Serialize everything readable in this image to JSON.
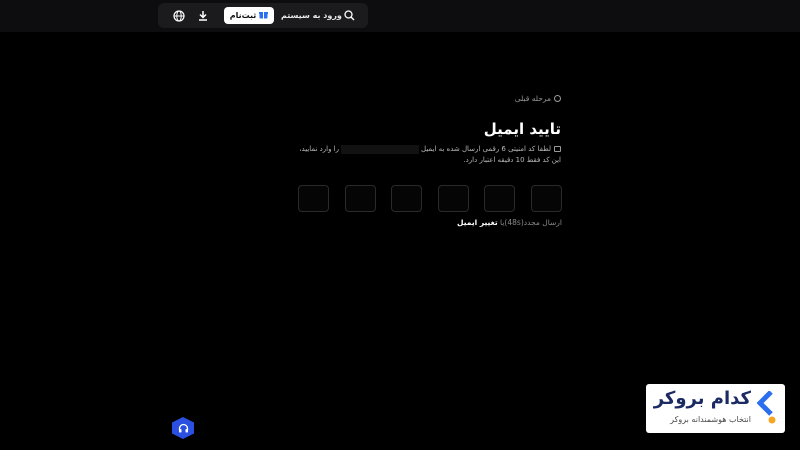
{
  "header": {
    "login_label": "ورود به سیستم",
    "signup_label": "ثبت‌نام"
  },
  "verify": {
    "back_label": "مرحله قبلی",
    "title": "تایید ایمیل",
    "desc_line1_a": "لطفا کد امنیتی 6 رقمی ارسال شده به ایمیل",
    "desc_line1_b": "را وارد نمایید،",
    "desc_line2": "این کد فقط 10 دقیقه اعتبار دارد.",
    "otp_count": 6,
    "resend_label": "ارسال مجدد",
    "countdown": "(48s)",
    "or_label": "یا",
    "change_email_label": "تغییر ایمیل"
  },
  "watermark": {
    "name": "کدام بروکر",
    "tagline": "انتخاب هوشمندانه بروکر"
  },
  "colors": {
    "background": "#000000",
    "topbar": "#0d0d0f",
    "accent": "#2b4fe0",
    "brand": "#1c2a63",
    "brand_dot": "#f5a623"
  },
  "icons": [
    "globe-icon",
    "download-icon",
    "gift-icon",
    "search-icon",
    "back-icon",
    "mail-icon",
    "headset-icon",
    "brand-logo-icon"
  ]
}
